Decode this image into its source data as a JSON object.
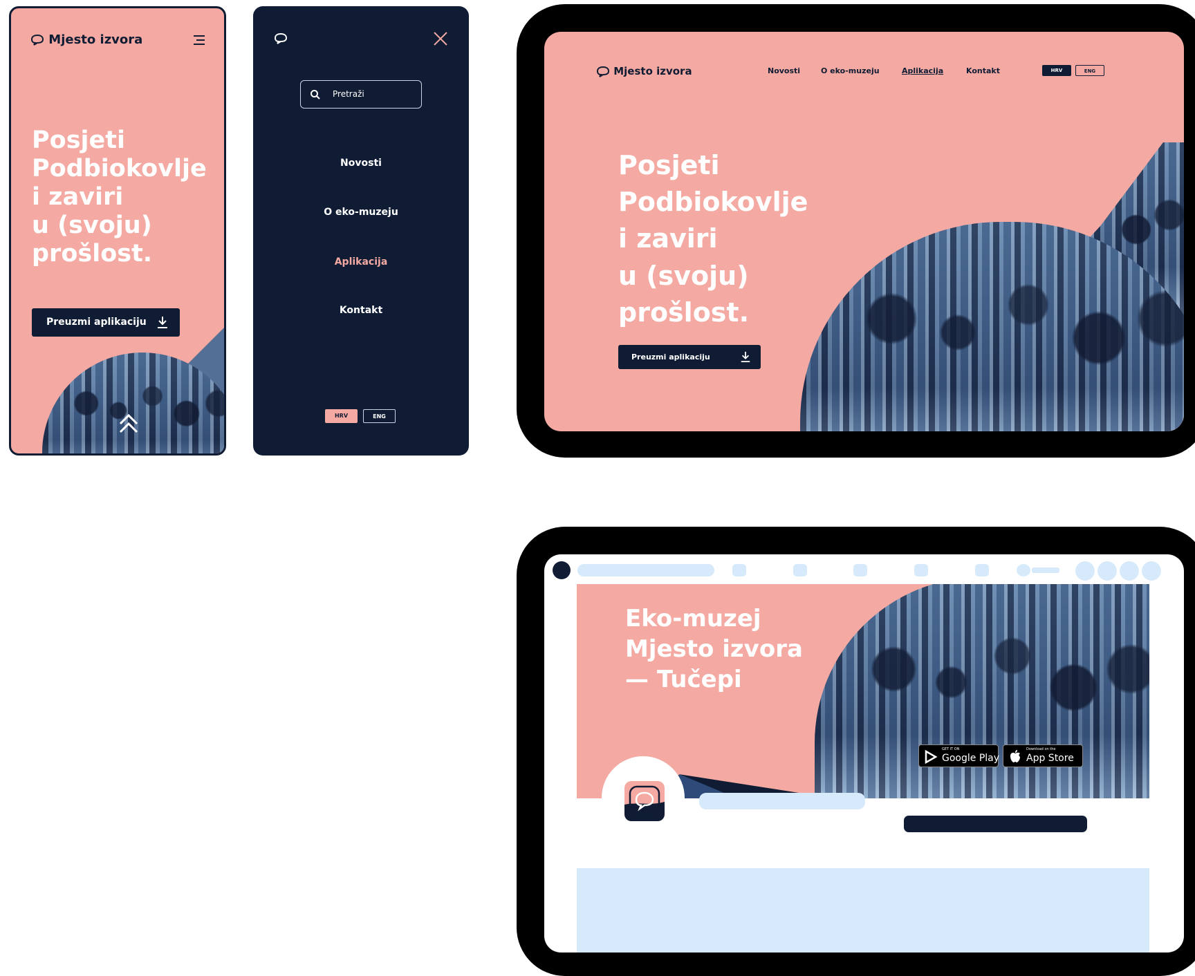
{
  "colors": {
    "navy": "#0f1c33",
    "salmon": "#f4a9a2",
    "light_blue_skeleton": "#d6eafb",
    "device_frame": "#000000"
  },
  "brand": {
    "name": "Mjesto izvora"
  },
  "hero": {
    "line1": "Posjeti",
    "line2": "Podbiokovlje",
    "line3": "i zaviri",
    "line4": "u (svoju)",
    "line5": "prošlost.",
    "cta_label": "Preuzmi aplikaciju"
  },
  "menu": {
    "search_placeholder": "Pretraži",
    "items": [
      "Novosti",
      "O eko-muzeju",
      "Aplikacija",
      "Kontakt"
    ],
    "active_item": "Aplikacija"
  },
  "language": {
    "hrv": "HRV",
    "eng": "ENG",
    "active": "HRV"
  },
  "store_page": {
    "banner_line1": "Eko-muzej",
    "banner_line2": "Mjesto izvora",
    "banner_line3": "— Tučepi",
    "google_play_small": "GET IT ON",
    "google_play_big": "Google Play",
    "app_store_small": "Download on the",
    "app_store_big": "App Store"
  },
  "icons": {
    "logo": "speech-bubble-icon",
    "menu": "hamburger-icon",
    "close": "close-icon",
    "search": "search-icon",
    "download": "download-arrow-icon",
    "scroll_up": "double-chevron-up-icon",
    "google_play": "play-triangle-icon",
    "apple": "apple-icon"
  }
}
